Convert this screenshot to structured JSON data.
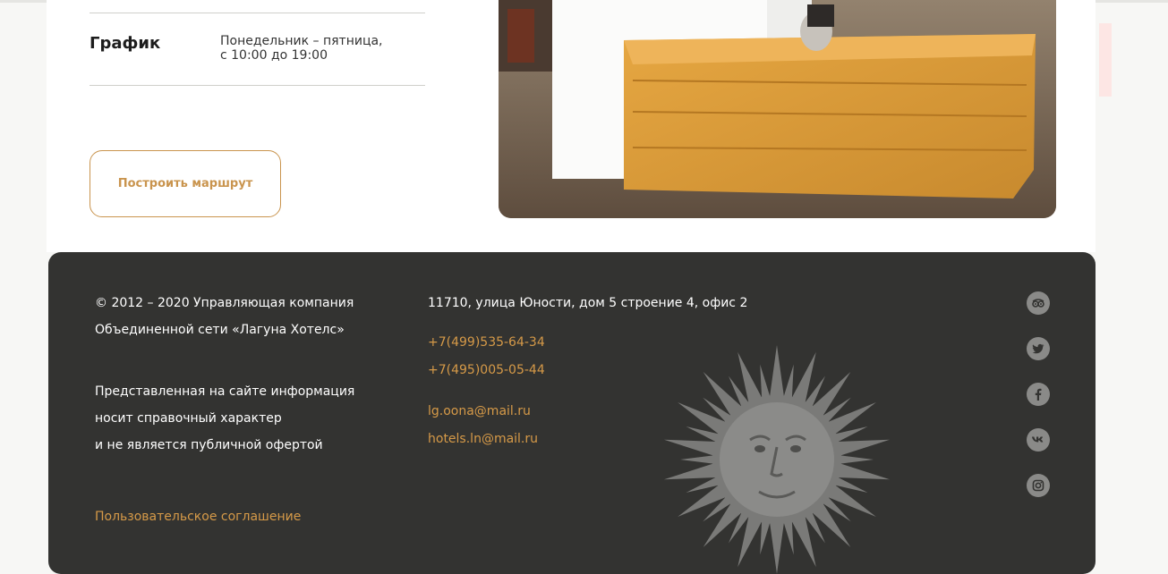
{
  "schedule": {
    "label": "График",
    "value": "Понедельник – пятница,\nс 10:00 до 19:00"
  },
  "route_button": {
    "label": "Построить маршрут"
  },
  "footer": {
    "copyright": "© 2012 – 2020 Управляющая компания\nОбъединенной сети «Лагуна Хотелс»",
    "disclaimer": "Представленная на сайте информация\nносит справочный характер\nи не является публичной офертой",
    "agreement_link": "Пользовательское соглашение",
    "address": "11710, улица Юности, дом 5 строение 4, офис 2",
    "phones": [
      "+7(499)535-64-34",
      "+7(495)005-05-44"
    ],
    "emails": [
      "lg.oona@mail.ru",
      "hotels.ln@mail.ru"
    ],
    "social_icons": [
      "tripadvisor-icon",
      "twitter-icon",
      "facebook-icon",
      "vk-icon",
      "instagram-icon"
    ]
  },
  "colors": {
    "accent": "#d69a48",
    "button_accent": "#c9944e",
    "footer_bg": "#333331",
    "icon_bg": "#8a8a88"
  }
}
